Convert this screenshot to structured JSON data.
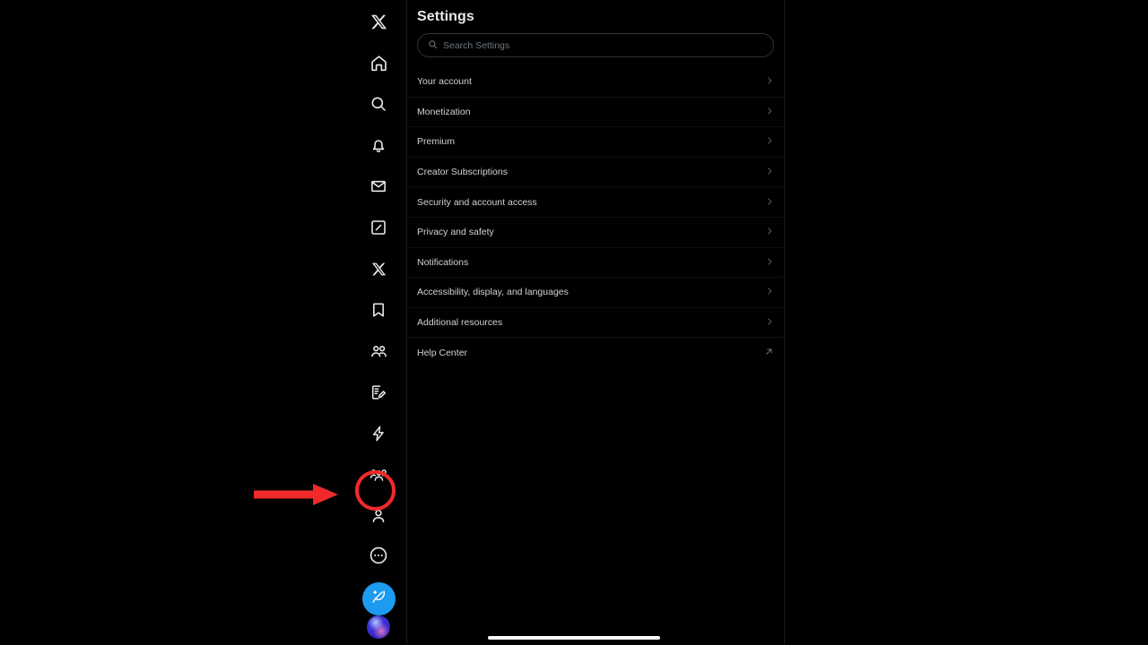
{
  "sidebar": {
    "items": [
      {
        "name": "x-logo",
        "label": "X"
      },
      {
        "name": "home",
        "label": "Home"
      },
      {
        "name": "explore",
        "label": "Explore"
      },
      {
        "name": "notifications",
        "label": "Notifications"
      },
      {
        "name": "messages",
        "label": "Messages"
      },
      {
        "name": "grok-square",
        "label": "Grok"
      },
      {
        "name": "x-secondary",
        "label": "X"
      },
      {
        "name": "bookmarks",
        "label": "Bookmarks"
      },
      {
        "name": "communities",
        "label": "Communities"
      },
      {
        "name": "notes",
        "label": "Notes"
      },
      {
        "name": "moments",
        "label": "Moments"
      },
      {
        "name": "groups",
        "label": "Groups"
      },
      {
        "name": "profile",
        "label": "Profile"
      },
      {
        "name": "more",
        "label": "More"
      }
    ],
    "compose_label": "Post",
    "avatar_label": "Account"
  },
  "panel": {
    "title": "Settings",
    "search": {
      "placeholder": "Search Settings",
      "value": ""
    },
    "rows": [
      {
        "label": "Your account",
        "affordance": "chevron"
      },
      {
        "label": "Monetization",
        "affordance": "chevron"
      },
      {
        "label": "Premium",
        "affordance": "chevron"
      },
      {
        "label": "Creator Subscriptions",
        "affordance": "chevron"
      },
      {
        "label": "Security and account access",
        "affordance": "chevron"
      },
      {
        "label": "Privacy and safety",
        "affordance": "chevron"
      },
      {
        "label": "Notifications",
        "affordance": "chevron"
      },
      {
        "label": "Accessibility, display, and languages",
        "affordance": "chevron"
      },
      {
        "label": "Additional resources",
        "affordance": "chevron"
      },
      {
        "label": "Help Center",
        "affordance": "external"
      }
    ]
  },
  "annotation": {
    "color": "#f02a2a",
    "target": "more",
    "arrow_label": "pointer-arrow",
    "circle_label": "highlight-circle"
  },
  "colors": {
    "accent": "#1d9bf0",
    "background": "#000000",
    "text_primary": "#e7e9ea",
    "text_secondary": "#6e767d",
    "divider": "#2f3336",
    "annotation": "#f02a2a"
  }
}
